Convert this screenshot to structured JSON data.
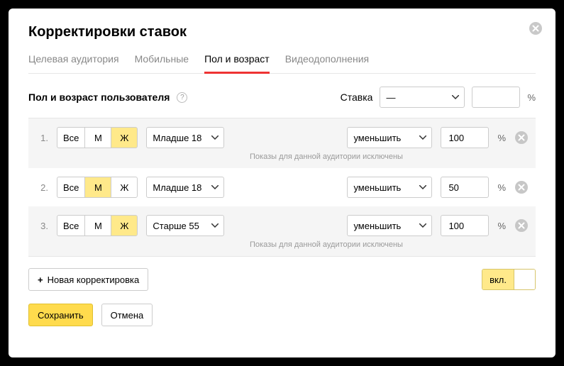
{
  "title": "Корректировки ставок",
  "tabs": [
    {
      "label": "Целевая аудитория",
      "active": false
    },
    {
      "label": "Мобильные",
      "active": false
    },
    {
      "label": "Пол и возраст",
      "active": true
    },
    {
      "label": "Видеодополнения",
      "active": false
    }
  ],
  "filter": {
    "label": "Пол и возраст пользователя",
    "stavka_label": "Ставка",
    "stavka_value": "—",
    "pct_value": "",
    "pct_sign": "%"
  },
  "gender_labels": {
    "all": "Все",
    "m": "М",
    "f": "Ж"
  },
  "rows": [
    {
      "idx": "1.",
      "gender": "f",
      "age": "Младше 18",
      "action": "уменьшить",
      "value": "100",
      "note": "Показы для данной аудитории исключены"
    },
    {
      "idx": "2.",
      "gender": "m",
      "age": "Младше 18",
      "action": "уменьшить",
      "value": "50",
      "note": ""
    },
    {
      "idx": "3.",
      "gender": "f",
      "age": "Старше 55",
      "action": "уменьшить",
      "value": "100",
      "note": "Показы для данной аудитории исключены"
    }
  ],
  "add_button": "Новая корректировка",
  "toggle_label": "вкл.",
  "save": "Сохранить",
  "cancel": "Отмена"
}
